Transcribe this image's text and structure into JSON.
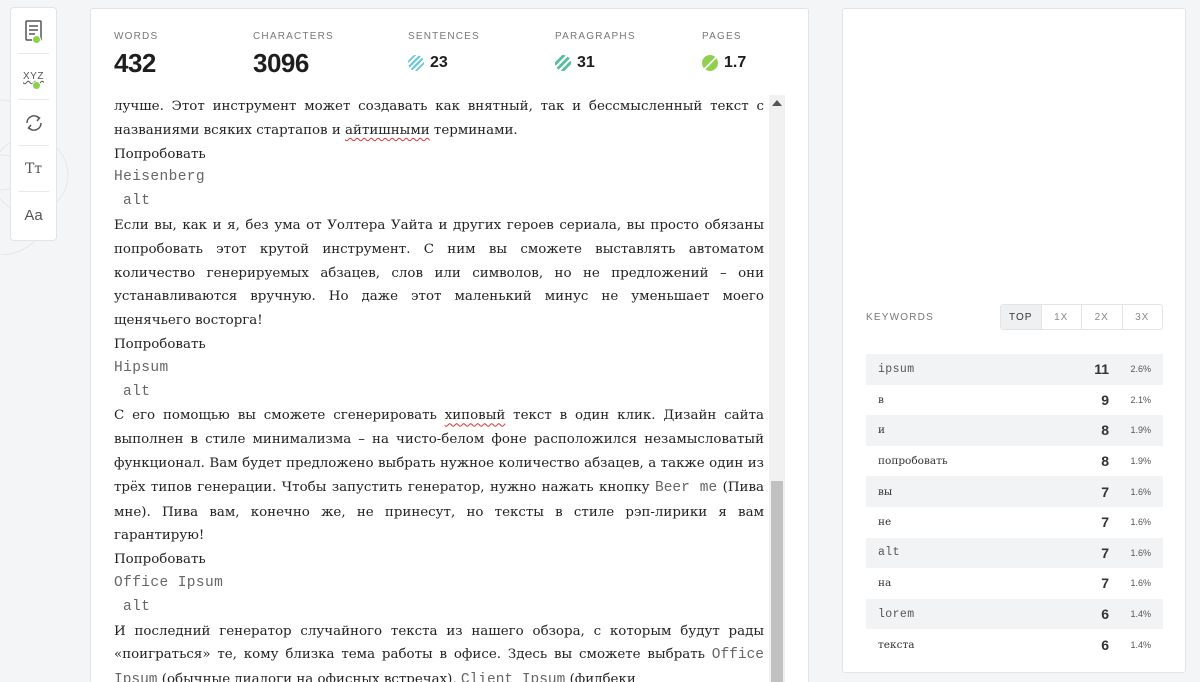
{
  "toolbar": {
    "tools": [
      {
        "icon": "save-doc-icon"
      },
      {
        "icon": "spellcheck-icon",
        "glyph": "XYZ"
      },
      {
        "icon": "refresh-icon"
      },
      {
        "icon": "text-size-icon",
        "glyph": "Tт"
      },
      {
        "icon": "font-icon",
        "glyph": "Aa"
      }
    ]
  },
  "stats": {
    "words": {
      "label": "WORDS",
      "value": "432"
    },
    "characters": {
      "label": "CHARACTERS",
      "value": "3096"
    },
    "sentences": {
      "label": "SENTENCES",
      "value": "23"
    },
    "paragraphs": {
      "label": "PARAGRAPHS",
      "value": "31"
    },
    "pages": {
      "label": "PAGES",
      "value": "1.7"
    }
  },
  "editor": {
    "p1a": "лучше. Этот инструмент может создавать как внятный, так и бессмысленный текст с названиями всяких стартапов и ",
    "p1_squig": "айтишными",
    "p1b": " терминами.",
    "try1": "Попробовать",
    "name1": "Heisenberg",
    "alt1": "alt",
    "p2": "Если вы, как и я, без ума от Уолтера Уайта и других героев сериала, вы просто обязаны попробовать этот крутой инструмент. С ним вы сможете выставлять автоматом количество генерируемых абзацев, слов или символов, но не предложений – они устанавливаются вручную. Но даже этот маленький минус не уменьшает моего щенячьего восторга!",
    "try2": "Попробовать",
    "name2": "Hipsum",
    "alt2": "alt",
    "p3a": "С его помощью вы сможете сгенерировать ",
    "p3_squig": "хиповый",
    "p3b": " текст в один клик. Дизайн сайта выполнен в стиле минимализма – на чисто-белом фоне расположился незамысловатый функционал. Вам будет предложено выбрать нужное количество абзацев, а также один из трёх типов генерации. Чтобы запустить генератор, нужно нажать кнопку ",
    "p3_mono": "Beer me",
    "p3c": " (Пива мне). Пива вам, конечно же, не принесут, но тексты в стиле рэп-лирики я вам гарантирую!",
    "try3": "Попробовать",
    "name3": "Office Ipsum",
    "alt3": "alt",
    "p4a": "И последний генератор случайного текста из нашего обзора, с которым будут рады «поиграться» те, кому близка тема работы в офисе. Здесь вы сможете выбрать ",
    "p4_mono1": "Office Ipsum",
    "p4b": " (обычные диалоги на офисных встречах), ",
    "p4_mono2": "Client Ipsum",
    "p4c": " (фидбеки"
  },
  "keywords": {
    "title": "KEYWORDS",
    "tabs": [
      "TOP",
      "1X",
      "2X",
      "3X"
    ],
    "active_tab": "TOP",
    "rows": [
      {
        "word": "ipsum",
        "count": "11",
        "pct": "2.6%"
      },
      {
        "word": "в",
        "count": "9",
        "pct": "2.1%"
      },
      {
        "word": "и",
        "count": "8",
        "pct": "1.9%"
      },
      {
        "word": "попробовать",
        "count": "8",
        "pct": "1.9%"
      },
      {
        "word": "вы",
        "count": "7",
        "pct": "1.6%"
      },
      {
        "word": "не",
        "count": "7",
        "pct": "1.6%"
      },
      {
        "word": "alt",
        "count": "7",
        "pct": "1.6%"
      },
      {
        "word": "на",
        "count": "7",
        "pct": "1.6%"
      },
      {
        "word": "lorem",
        "count": "6",
        "pct": "1.4%"
      },
      {
        "word": "текста",
        "count": "6",
        "pct": "1.4%"
      }
    ]
  },
  "colors": {
    "accent_green": "#8bd14a",
    "sentences_badge": "#66c9db",
    "paragraphs_badge": "#55c09a",
    "spell_error": "#dd3333"
  }
}
